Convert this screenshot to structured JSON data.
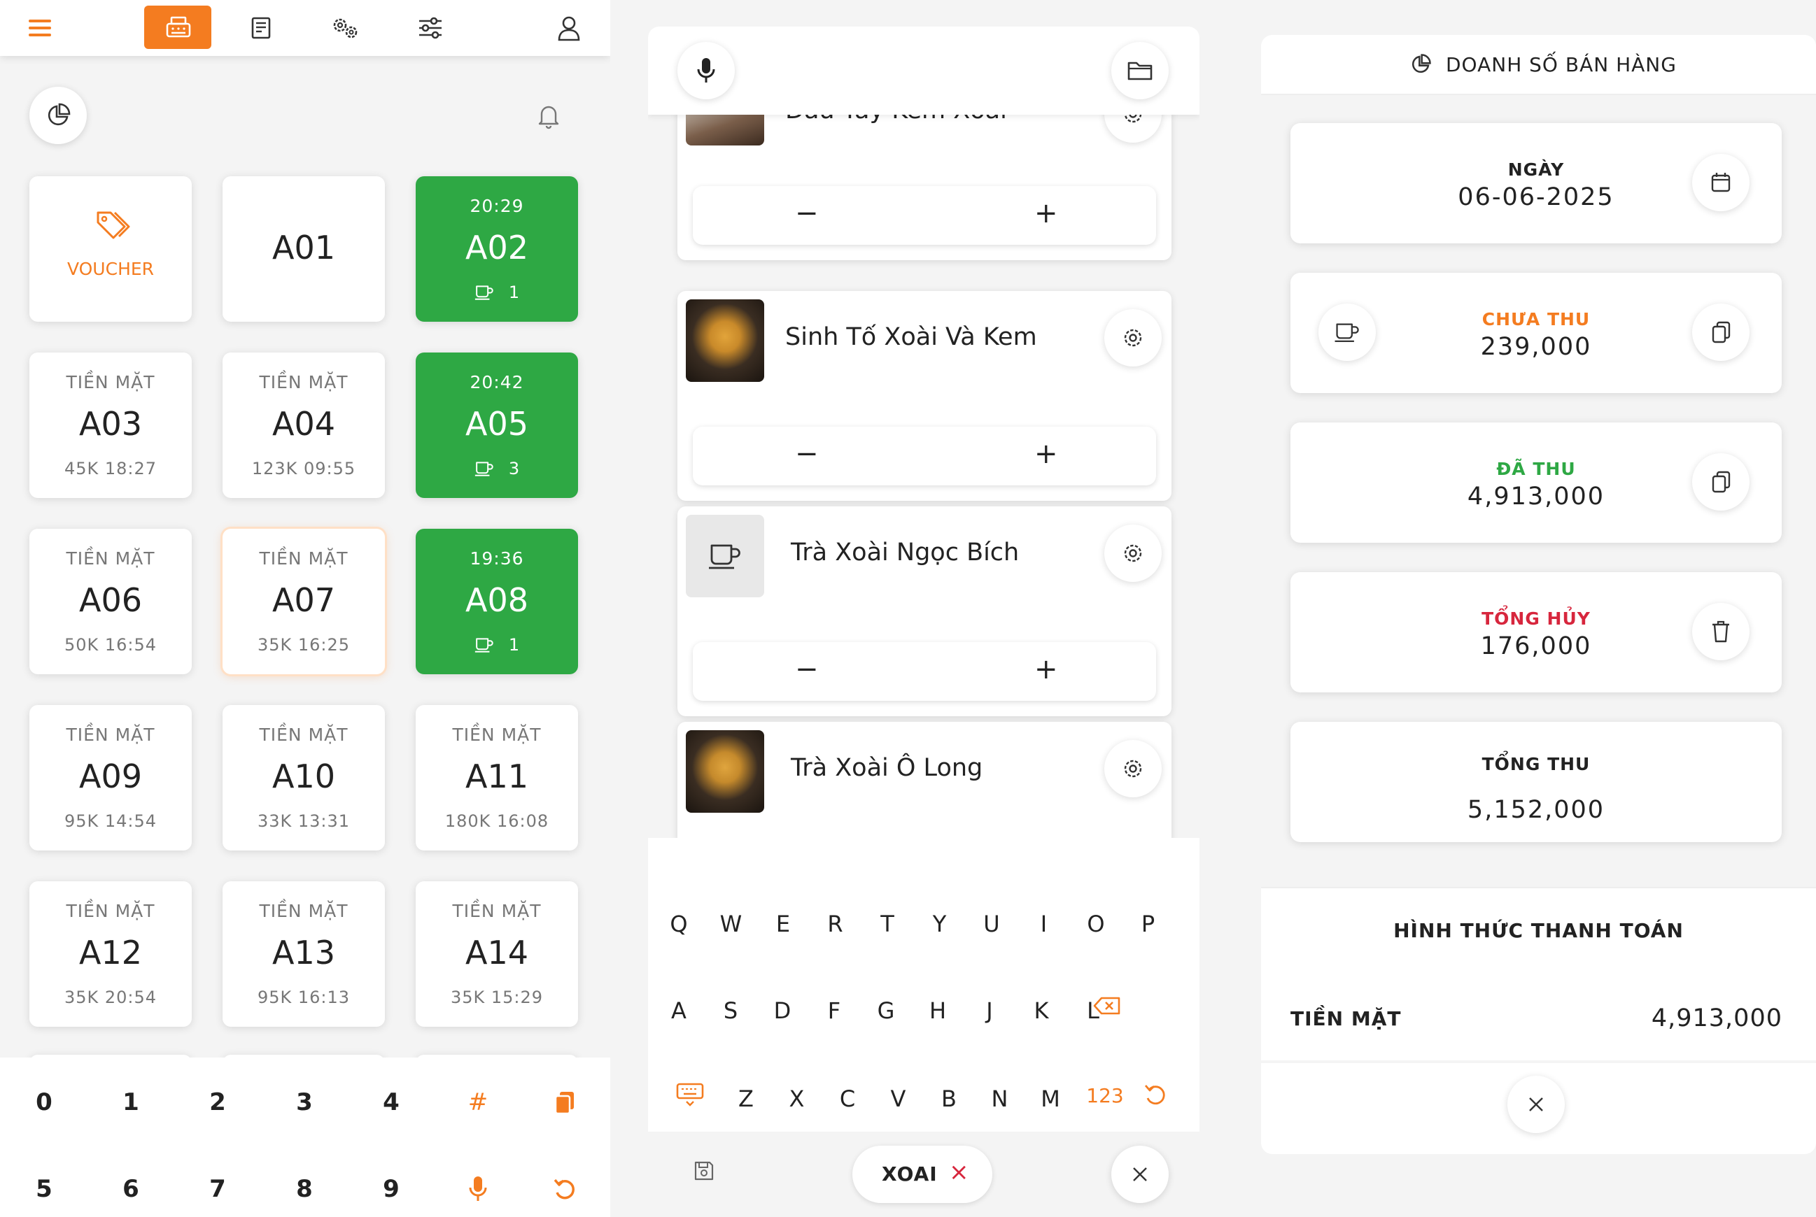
{
  "colors": {
    "accent": "#f47c20",
    "green": "#2ea844",
    "red": "#d7263d"
  },
  "panel1": {
    "header_icons": [
      "menu-icon",
      "cash-register-icon",
      "kitchen-order-icon",
      "settings-gears-icon",
      "filters-icon",
      "user-icon"
    ],
    "voucher_label": "VOUCHER",
    "tables": [
      {
        "name": "A01",
        "top": "",
        "bottom": "",
        "state": "empty"
      },
      {
        "name": "A02",
        "top": "20:29",
        "bottom": "1",
        "state": "green"
      },
      {
        "name": "A03",
        "top": "TIỀN MẶT",
        "bottom": "45K 18:27",
        "state": "paid"
      },
      {
        "name": "A04",
        "top": "TIỀN MẶT",
        "bottom": "123K 09:55",
        "state": "paid"
      },
      {
        "name": "A05",
        "top": "20:42",
        "bottom": "3",
        "state": "green"
      },
      {
        "name": "A06",
        "top": "TIỀN MẶT",
        "bottom": "50K 16:54",
        "state": "paid"
      },
      {
        "name": "A07",
        "top": "TIỀN MẶT",
        "bottom": "35K 16:25",
        "state": "selected"
      },
      {
        "name": "A08",
        "top": "19:36",
        "bottom": "1",
        "state": "green"
      },
      {
        "name": "A09",
        "top": "TIỀN MẶT",
        "bottom": "95K 14:54",
        "state": "paid"
      },
      {
        "name": "A10",
        "top": "TIỀN MẶT",
        "bottom": "33K 13:31",
        "state": "paid"
      },
      {
        "name": "A11",
        "top": "TIỀN MẶT",
        "bottom": "180K 16:08",
        "state": "paid"
      },
      {
        "name": "A12",
        "top": "TIỀN MẶT",
        "bottom": "35K 20:54",
        "state": "paid"
      },
      {
        "name": "A13",
        "top": "TIỀN MẶT",
        "bottom": "95K 16:13",
        "state": "paid"
      },
      {
        "name": "A14",
        "top": "TIỀN MẶT",
        "bottom": "35K 15:29",
        "state": "paid"
      }
    ],
    "numpad_row1": [
      "0",
      "1",
      "2",
      "3",
      "4",
      "#"
    ],
    "numpad_row2": [
      "5",
      "6",
      "7",
      "8",
      "9"
    ]
  },
  "panel2": {
    "products": [
      {
        "name": "Dâu Tây Kem Xoài"
      },
      {
        "name": "Sinh Tố Xoài Và Kem"
      },
      {
        "name": "Trà Xoài Ngọc Bích"
      },
      {
        "name": "Trà Xoài Ô Long"
      }
    ],
    "minus": "−",
    "plus": "+",
    "keyboard": {
      "row1": [
        "Q",
        "W",
        "E",
        "R",
        "T",
        "Y",
        "U",
        "I",
        "O",
        "P"
      ],
      "row2": [
        "A",
        "S",
        "D",
        "F",
        "G",
        "H",
        "J",
        "K",
        "L"
      ],
      "row3": [
        "Z",
        "X",
        "C",
        "V",
        "B",
        "N",
        "M"
      ],
      "numbers_key": "123"
    },
    "search_chip": "XOAI",
    "chip_close": "×"
  },
  "panel3": {
    "title": "DOANH SỐ BÁN HÀNG",
    "date_label": "NGÀY",
    "date_value": "06-06-2025",
    "unpaid_label": "CHƯA THU",
    "unpaid_value": "239,000",
    "paid_label": "ĐÃ THU",
    "paid_value": "4,913,000",
    "cancel_label": "TỔNG HỦY",
    "cancel_value": "176,000",
    "total_label": "TỔNG THU",
    "total_value": "5,152,000",
    "payment_section": "HÌNH THỨC THANH TOÁN",
    "cash_label": "TIỀN MẶT",
    "cash_value": "4,913,000"
  }
}
